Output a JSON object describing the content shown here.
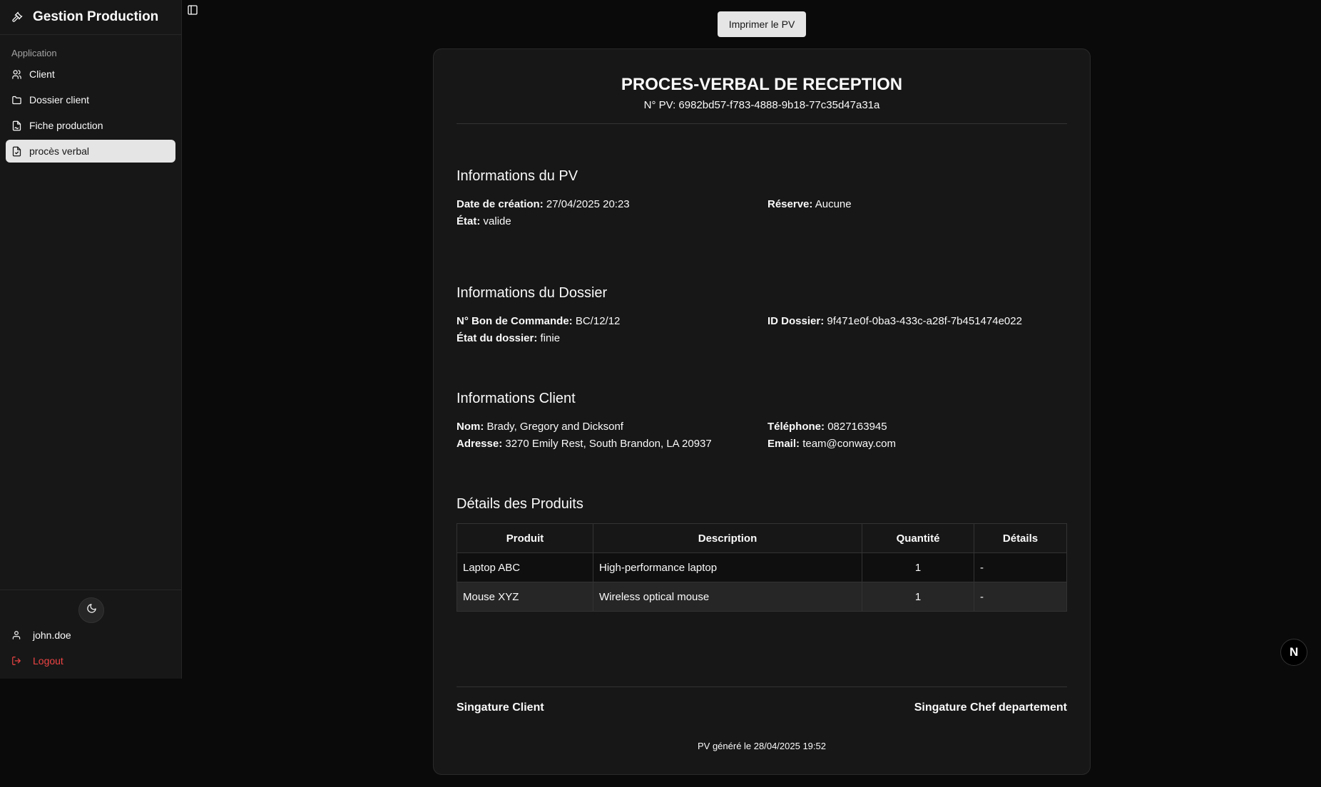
{
  "sidebar": {
    "brand": "Gestion Production",
    "group_label": "Application",
    "items": [
      {
        "label": "Client",
        "icon": "users-icon"
      },
      {
        "label": "Dossier client",
        "icon": "folder-icon"
      },
      {
        "label": "Fiche production",
        "icon": "file-signature-icon"
      },
      {
        "label": "procès verbal",
        "icon": "file-check-icon",
        "active": true
      }
    ],
    "user": "john.doe",
    "logout": "Logout"
  },
  "toolbar": {
    "print_label": "Imprimer le PV"
  },
  "doc": {
    "title": "PROCES-VERBAL DE RECEPTION",
    "pv_number": "N° PV: 6982bd57-f783-4888-9b18-77c35d47a31a",
    "pv_info": {
      "title": "Informations du PV",
      "created_label": "Date de création:",
      "created_value": "27/04/2025 20:23",
      "state_label": "État:",
      "state_value": "valide",
      "reserve_label": "Réserve:",
      "reserve_value": "Aucune"
    },
    "dossier_info": {
      "title": "Informations du Dossier",
      "order_label": "N° Bon de Commande:",
      "order_value": "BC/12/12",
      "state_label": "État du dossier:",
      "state_value": "finie",
      "id_label": "ID Dossier:",
      "id_value": "9f471e0f-0ba3-433c-a28f-7b451474e022"
    },
    "client_info": {
      "title": "Informations Client",
      "name_label": "Nom:",
      "name_value": "Brady, Gregory and Dicksonf",
      "address_label": "Adresse:",
      "address_value": "3270 Emily Rest, South Brandon, LA 20937",
      "phone_label": "Téléphone:",
      "phone_value": "0827163945",
      "email_label": "Email:",
      "email_value": "team@conway.com"
    },
    "products": {
      "title": "Détails des Produits",
      "columns": [
        "Produit",
        "Description",
        "Quantité",
        "Détails"
      ],
      "rows": [
        [
          "Laptop ABC",
          "High-performance laptop",
          "1",
          "-"
        ],
        [
          "Mouse XYZ",
          "Wireless optical mouse",
          "1",
          "-"
        ]
      ]
    },
    "signature_client": "Singature Client",
    "signature_chef": "Singature Chef departement",
    "generated": "PV généré le 28/04/2025 19:52"
  },
  "badge": "N"
}
